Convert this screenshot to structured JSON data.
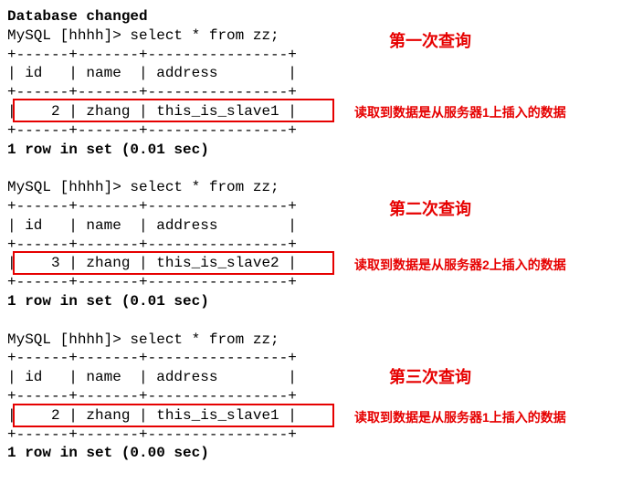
{
  "header_line": "Database changed",
  "queries": [
    {
      "prompt": "MySQL [hhhh]> select * from zz;",
      "border": "+------+-------+----------------+",
      "header_row": "| id   | name  | address        |",
      "data_row": "|    2 | zhang | this_is_slave1 |",
      "footer": "1 row in set (0.01 sec)",
      "title": "第一次查询",
      "note": "读取到数据是从服务器1上插入的数据"
    },
    {
      "prompt": "MySQL [hhhh]> select * from zz;",
      "border": "+------+-------+----------------+",
      "header_row": "| id   | name  | address        |",
      "data_row": "|    3 | zhang | this_is_slave2 |",
      "footer": "1 row in set (0.01 sec)",
      "title": "第二次查询",
      "note": "读取到数据是从服务器2上插入的数据"
    },
    {
      "prompt": "MySQL [hhhh]> select * from zz;",
      "border": "+------+-------+----------------+",
      "header_row": "| id   | name  | address        |",
      "data_row": "|    2 | zhang | this_is_slave1 |",
      "footer": "1 row in set (0.00 sec)",
      "title": "第三次查询",
      "note": "读取到数据是从服务器1上插入的数据"
    }
  ],
  "chart_data": {
    "type": "table",
    "title": "MySQL select * from zz — three consecutive reads",
    "columns": [
      "id",
      "name",
      "address"
    ],
    "series": [
      {
        "name": "第一次查询",
        "values": [
          2,
          "zhang",
          "this_is_slave1"
        ],
        "time_sec": 0.01
      },
      {
        "name": "第二次查询",
        "values": [
          3,
          "zhang",
          "this_is_slave2"
        ],
        "time_sec": 0.01
      },
      {
        "name": "第三次查询",
        "values": [
          2,
          "zhang",
          "this_is_slave1"
        ],
        "time_sec": 0.0
      }
    ]
  }
}
